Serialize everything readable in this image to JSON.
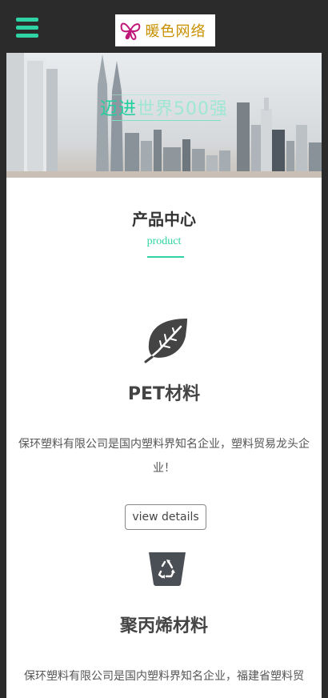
{
  "header": {
    "logo_text": "暖色网络"
  },
  "banner": {
    "slogan_highlight": "迈进",
    "slogan_rest": "世界500强"
  },
  "section": {
    "title": "产品中心",
    "subtitle": "product"
  },
  "products": [
    {
      "icon": "leaf-icon",
      "title": "PET材料",
      "description": "保环塑料有限公司是国内塑料界知名企业，塑料贸易龙头企业！",
      "button_label": "view details"
    },
    {
      "icon": "recycle-bin-icon",
      "title": "聚丙烯材料",
      "description": "保环塑料有限公司是国内塑料界知名企业，福建省塑料贸"
    }
  ],
  "colors": {
    "accent": "#2fd3a4",
    "background": "#2b2b2b"
  }
}
